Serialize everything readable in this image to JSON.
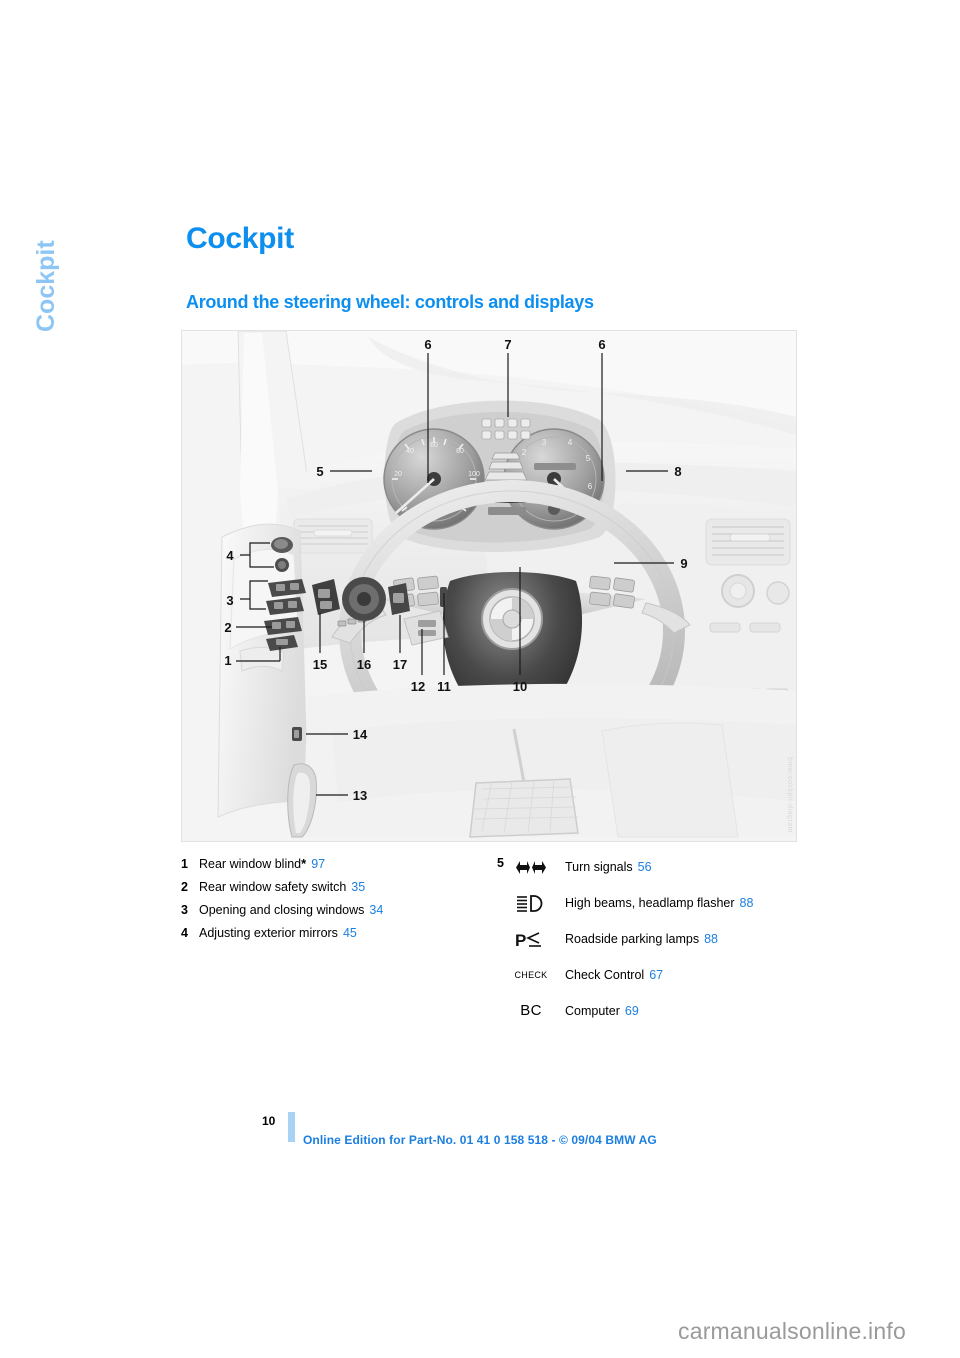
{
  "chapter_tab": "Cockpit",
  "page_title": "Cockpit",
  "section_title": "Around the steering wheel: controls and displays",
  "illustration": {
    "alt": "BMW cockpit: steering wheel, instrument cluster, door controls and pedals",
    "image_code": "bmw-cockpit-diagram",
    "callouts": [
      "1",
      "2",
      "3",
      "4",
      "5",
      "6",
      "7",
      "6",
      "8",
      "9",
      "10",
      "11",
      "12",
      "13",
      "14",
      "15",
      "16",
      "17"
    ]
  },
  "legend_left": [
    {
      "num": "1",
      "label": "Rear window blind",
      "star": "*",
      "page": "97"
    },
    {
      "num": "2",
      "label": "Rear window safety switch",
      "star": "",
      "page": "35"
    },
    {
      "num": "3",
      "label": "Opening and closing windows",
      "star": "",
      "page": "34"
    },
    {
      "num": "4",
      "label": "Adjusting exterior mirrors",
      "star": "",
      "page": "45"
    }
  ],
  "legend_right": {
    "num": "5",
    "items": [
      {
        "icon": "turn-signals-icon",
        "glyph_type": "svg",
        "label": "Turn signals",
        "page": "56"
      },
      {
        "icon": "high-beams-icon",
        "glyph_type": "svg",
        "label": "High beams, headlamp flasher",
        "page": "88"
      },
      {
        "icon": "roadside-parking-lamps-icon",
        "glyph_type": "svg",
        "label": "Roadside parking lamps",
        "page": "88"
      },
      {
        "icon": "check-control-icon",
        "glyph_type": "text",
        "glyph_text": "CHECK",
        "label": "Check Control",
        "page": "67"
      },
      {
        "icon": "computer-icon",
        "glyph_type": "text",
        "glyph_text": "BC",
        "label": "Computer",
        "page": "69"
      }
    ]
  },
  "footer": {
    "folio": "10",
    "text": "Online Edition for Part-No. 01 41 0 158 518 - © 09/04 BMW AG"
  },
  "watermark": "carmanualsonline.info",
  "colors": {
    "heading_blue": "#0d8ff0",
    "tab_blue": "#8dc6f5",
    "link_blue": "#1b7fe0",
    "folio_bar": "#a9d3f5",
    "illustration_bg": "#f2f2f2"
  }
}
